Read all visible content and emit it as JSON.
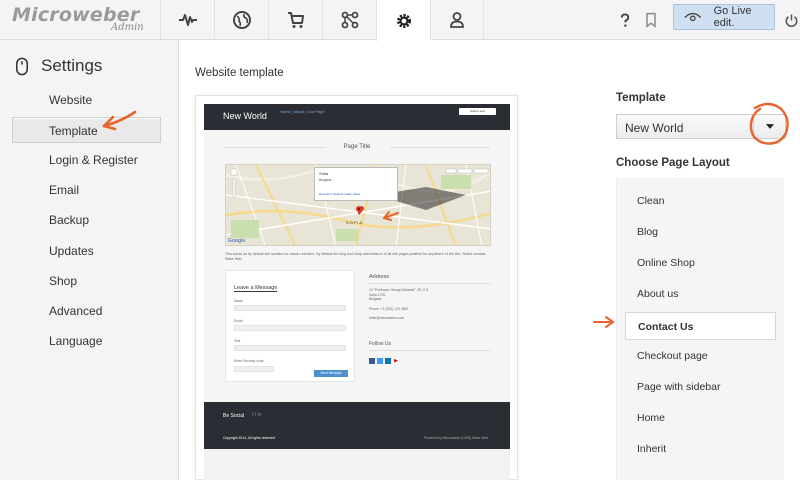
{
  "app": {
    "logo": "Microweber",
    "logo_sub": "Admin"
  },
  "topnav": {
    "tabs": [
      {
        "icon": "pulse-icon"
      },
      {
        "icon": "globe-icon"
      },
      {
        "icon": "cart-icon"
      },
      {
        "icon": "modules-icon"
      },
      {
        "icon": "gear-icon",
        "active": true
      },
      {
        "icon": "user-icon"
      }
    ],
    "help_icon": "question-icon",
    "bookmark_icon": "bookmark-icon",
    "go_live_label": "Go Live edit.",
    "power_icon": "power-icon"
  },
  "sidebar": {
    "title": "Settings",
    "items": [
      {
        "label": "Website"
      },
      {
        "label": "Template",
        "active": true
      },
      {
        "label": "Login & Register"
      },
      {
        "label": "Email"
      },
      {
        "label": "Backup"
      },
      {
        "label": "Updates"
      },
      {
        "label": "Shop"
      },
      {
        "label": "Advanced"
      },
      {
        "label": "Language"
      }
    ]
  },
  "main": {
    "title": "Website template"
  },
  "preview": {
    "site_name": "New World",
    "nav_links": "Home | About | Our Page",
    "header_button": "Add to cart",
    "page_title": "Page Title",
    "map_place": "Sofia",
    "map_country": "Bulgaria",
    "map_city_label": "SOFIA",
    "map_google": "Google",
    "map_popup_links": "Directions   Search nearby   Save",
    "description": "This works as by default site location for admin real time. By default the blog and shop uses feature of all site pages position for anywhere of the site. Select window. Make field.",
    "form_title": "Leave a Message",
    "form_fields": [
      "Name",
      "Email",
      "Text",
      "Enter Security code"
    ],
    "send_label": "Send Message",
    "address_title": "Address",
    "address_lines": [
      "10 \"Professor Georgi Zlatarski\", 3E, fl 5,",
      "Sofia 1700,",
      "Bulgaria"
    ],
    "phone": "Phone: +1 (313) 123 4567",
    "email": "hello@microweber.com",
    "follow_title": "Follow Us",
    "footer_social": "Be Social",
    "footer_copy": "Copyright 2014, All rights reserved",
    "footer_powered": "Powered by Microweber (CMS)  Make Web"
  },
  "template_panel": {
    "template_label": "Template",
    "template_value": "New World",
    "layout_label": "Choose Page Layout",
    "layouts": [
      {
        "label": "Clean"
      },
      {
        "label": "Blog"
      },
      {
        "label": "Online Shop"
      },
      {
        "label": "About us"
      },
      {
        "label": "Contact Us",
        "selected": true
      },
      {
        "label": "Checkout page"
      },
      {
        "label": "Page with sidebar"
      },
      {
        "label": "Home"
      },
      {
        "label": "Inherit"
      }
    ]
  },
  "colors": {
    "accent_orange": "#e8642c",
    "header_dark": "#2a2d33",
    "live_blue": "#cfe0f3"
  }
}
